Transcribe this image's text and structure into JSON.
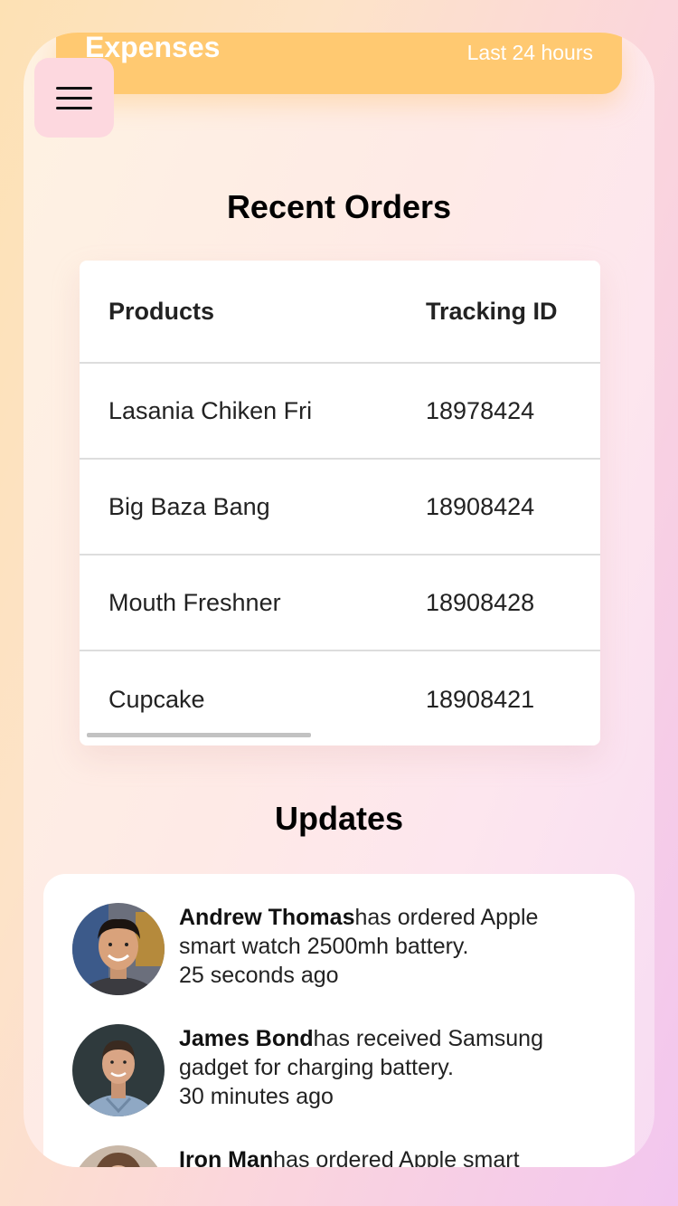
{
  "expenses": {
    "title": "Expenses",
    "period": "Last 24 hours",
    "color": "#ffc971"
  },
  "menu": {
    "icon": "hamburger-menu-icon"
  },
  "recent_orders": {
    "title": "Recent Orders",
    "columns": [
      "Products",
      "Tracking ID"
    ],
    "rows": [
      {
        "product": "Lasania Chiken Fri",
        "tracking_id": "18978424"
      },
      {
        "product": "Big Baza Bang",
        "tracking_id": "18908424"
      },
      {
        "product": "Mouth Freshner",
        "tracking_id": "18908428"
      },
      {
        "product": "Cupcake",
        "tracking_id": "18908421"
      }
    ]
  },
  "updates": {
    "title": "Updates",
    "items": [
      {
        "name": "Andrew Thomas",
        "action": "has ordered Apple smart watch 2500mh battery.",
        "time": "25 seconds ago"
      },
      {
        "name": "James Bond",
        "action": "has received Samsung gadget for charging battery.",
        "time": "30 minutes ago"
      },
      {
        "name": "Iron Man",
        "action": "has ordered Apple smart",
        "time": ""
      }
    ]
  }
}
